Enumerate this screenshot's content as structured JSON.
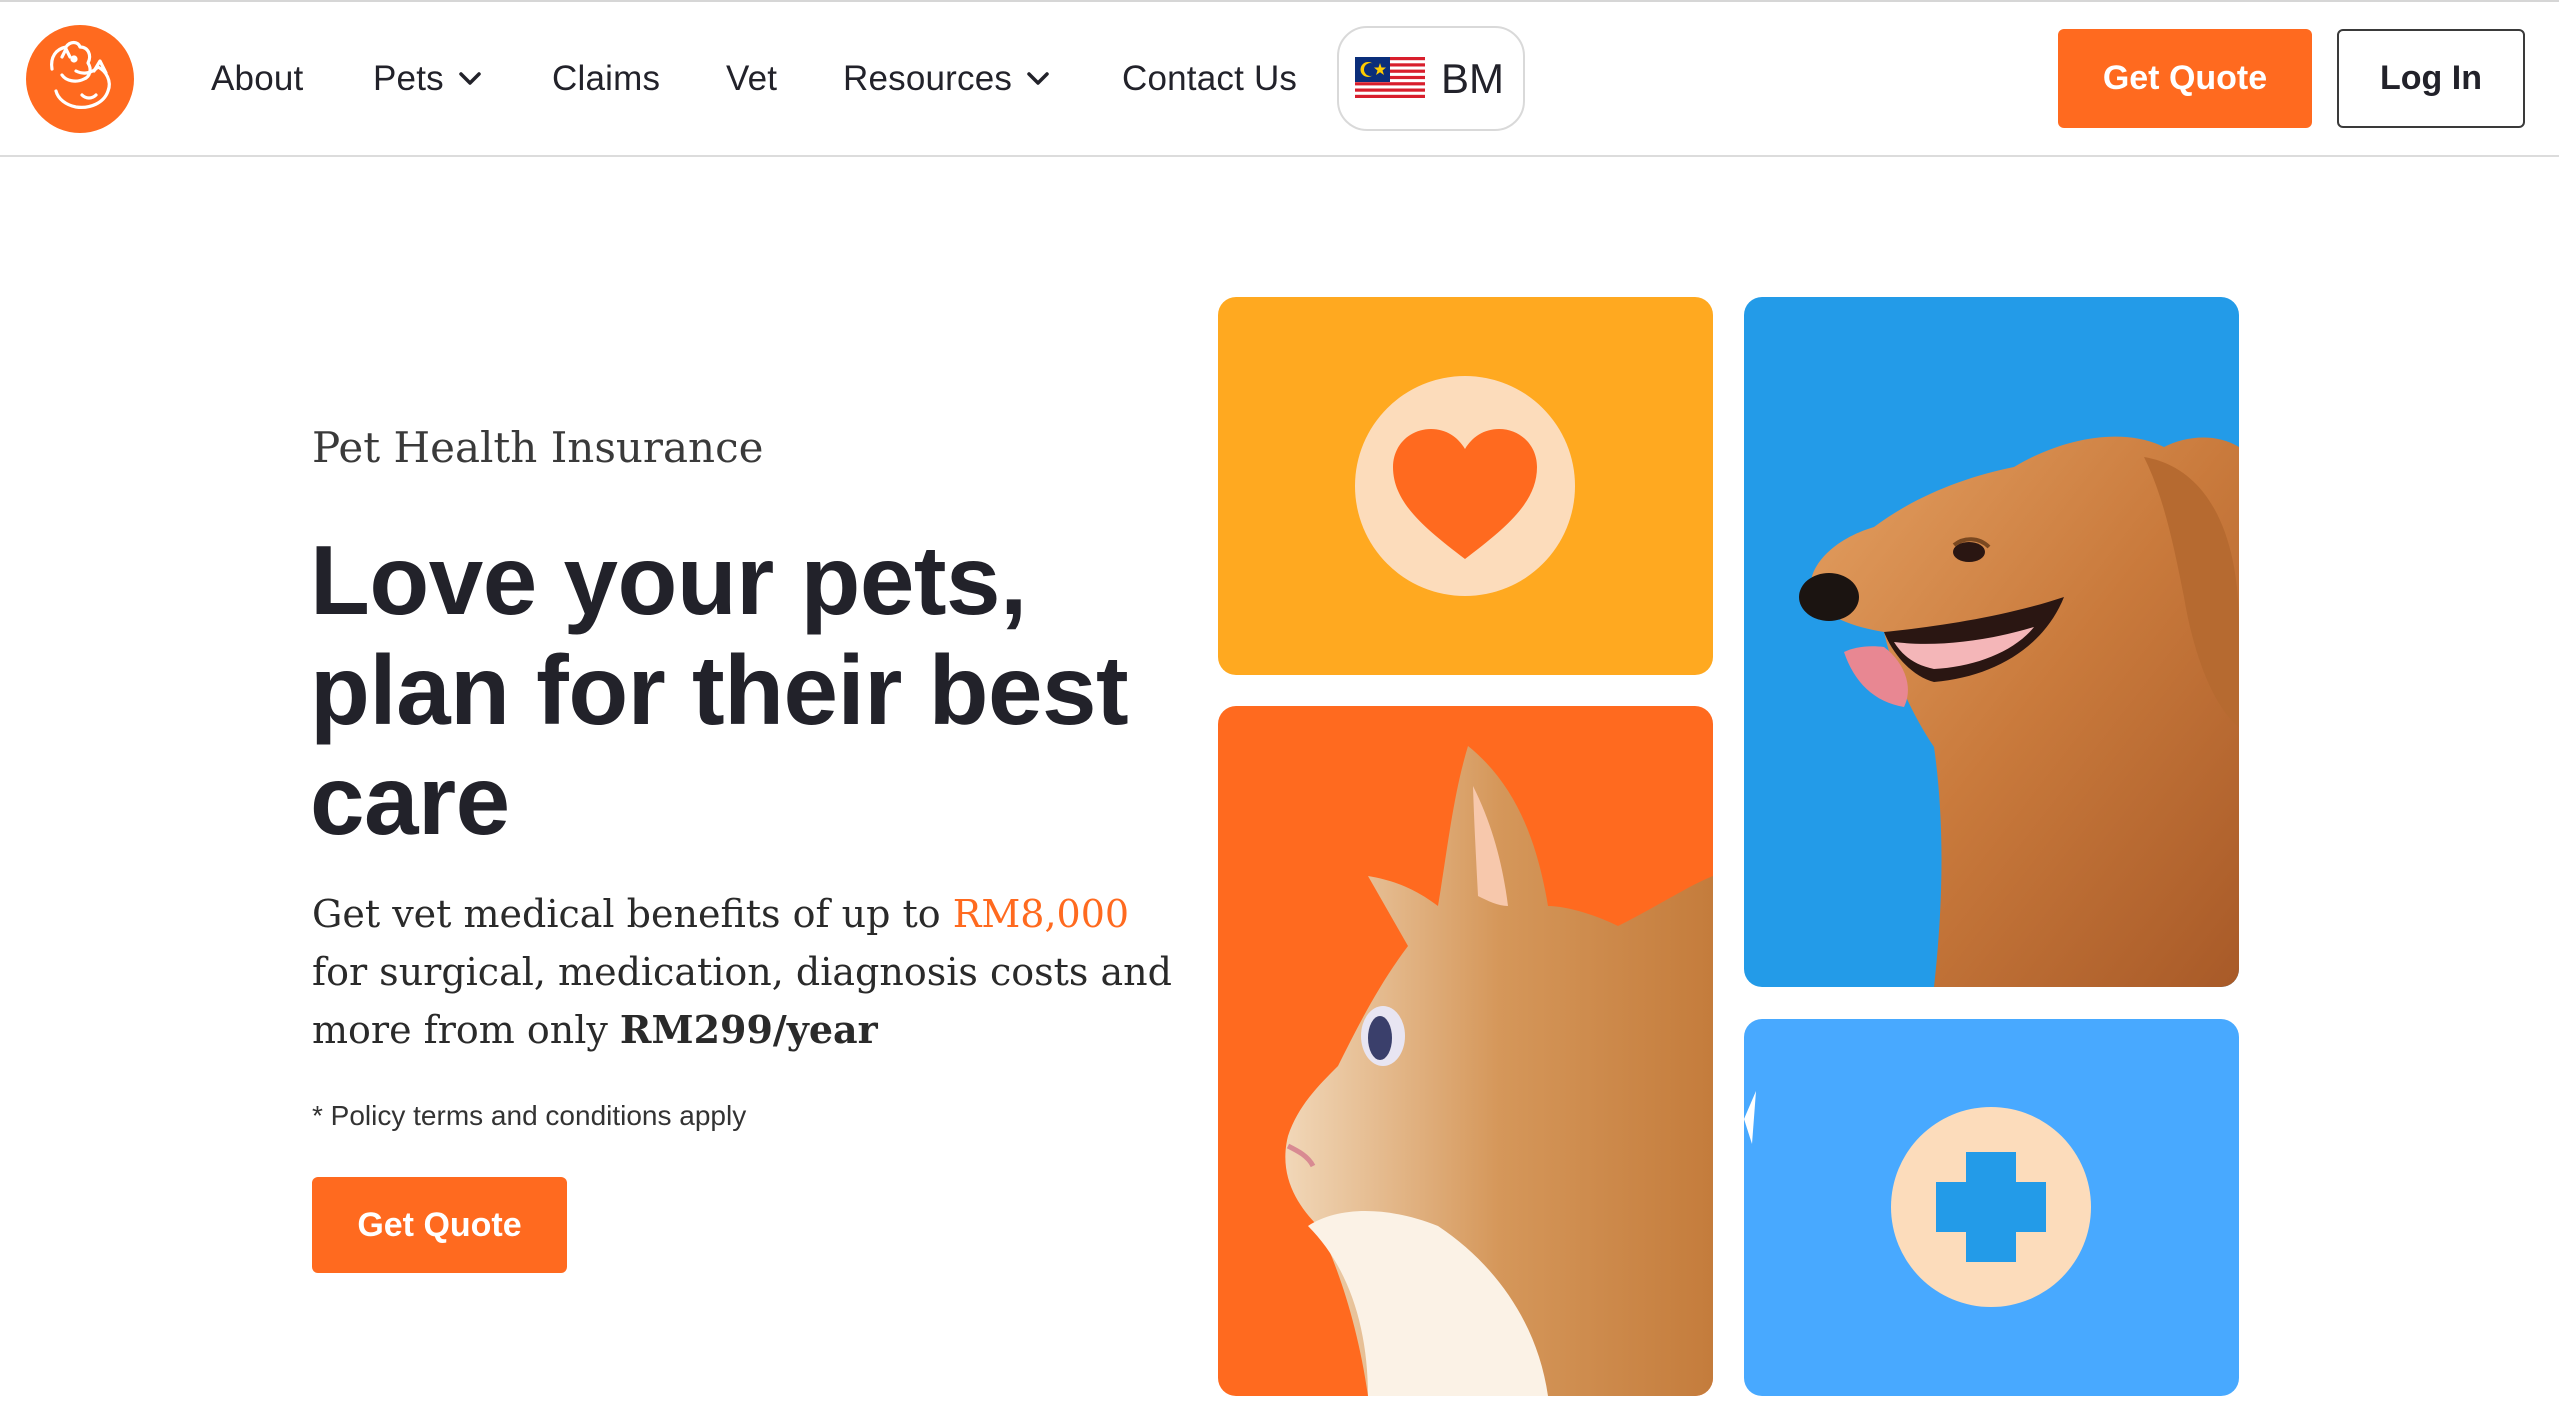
{
  "header": {
    "logo": {
      "icon": "cat-dog-logo-icon",
      "color": "#ff6a1f"
    },
    "nav": [
      {
        "label": "About"
      },
      {
        "label": "Pets",
        "has_dropdown": true
      },
      {
        "label": "Claims"
      },
      {
        "label": "Vet"
      },
      {
        "label": "Resources",
        "has_dropdown": true
      },
      {
        "label": "Contact Us"
      }
    ],
    "language": {
      "flag": "malaysia-flag-icon",
      "label": "BM"
    },
    "get_quote_label": "Get Quote",
    "login_label": "Log In"
  },
  "hero": {
    "eyebrow": "Pet Health Insurance",
    "headline_lines": [
      "Love your pets,",
      "plan for their best",
      "care"
    ],
    "description": {
      "part1": "Get vet medical benefits of up to ",
      "amount": "RM8,000",
      "part2": " for surgical, medication, diagnosis costs and more from only ",
      "price": "RM299/year"
    },
    "terms": "* Policy terms and conditions apply",
    "cta_label": "Get Quote"
  },
  "tiles": [
    {
      "name": "heart-tile",
      "icon": "heart-icon",
      "color": "#ffa920"
    },
    {
      "name": "dog-tile",
      "image": "golden-retriever",
      "color": "#239be8"
    },
    {
      "name": "cat-tile",
      "image": "ginger-cat",
      "color": "#ff6a1f"
    },
    {
      "name": "plus-tile",
      "icon": "medical-cross-icon",
      "color": "#48a9ff"
    }
  ],
  "colors": {
    "accent": "#ff6a1f",
    "text": "#22222a"
  }
}
